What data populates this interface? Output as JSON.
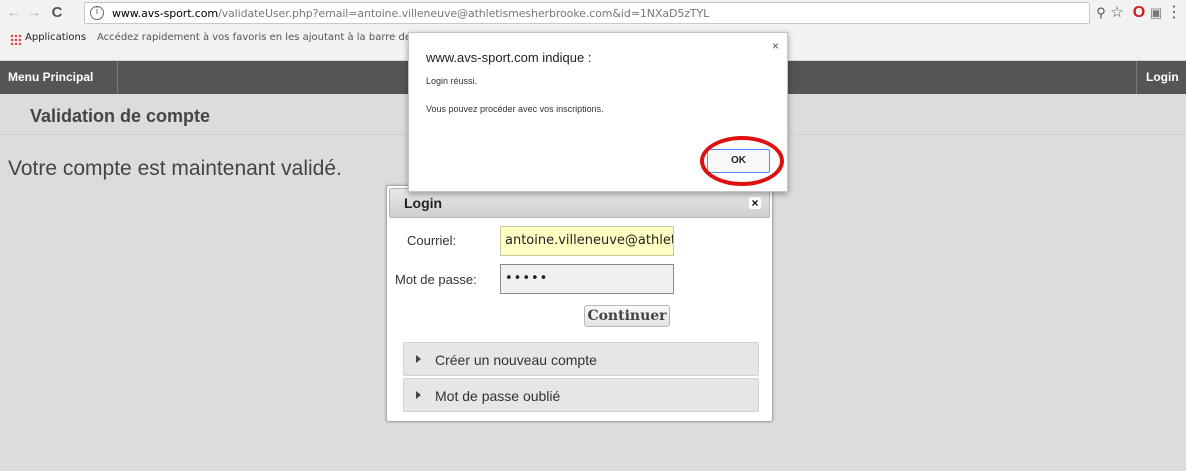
{
  "browser": {
    "url_host": "www.avs-sport.com",
    "url_rest": "/validateUser.php?email=antoine.villeneuve@athletismesherbrooke.com&id=1NXaD5zTYL",
    "apps_label": "Applications",
    "bookmarks_hint": "Accédez rapidement à vos favoris en les ajoutant à la barre de favo",
    "icons": {
      "back": "←",
      "forward": "→",
      "reload": "C",
      "info": "i",
      "key": "⚲",
      "star": "☆",
      "opera": "O",
      "extension": "▣",
      "menu": "⋮"
    }
  },
  "menu": {
    "main_label": "Menu Principal",
    "login_label": "Login"
  },
  "page": {
    "title": "Validation de compte",
    "message": "Votre compte est maintenant validé."
  },
  "login_dialog": {
    "title": "Login",
    "close_glyph": "×",
    "email_label": "Courriel:",
    "email_value": "antoine.villeneuve@athletis",
    "password_label": "Mot de passe:",
    "password_value": "•••••",
    "continue_label": "Continuer",
    "create_account_label": "Créer un nouveau compte",
    "forgot_password_label": "Mot de passe oublié"
  },
  "alert": {
    "title": "www.avs-sport.com indique :",
    "close_glyph": "×",
    "line1": "Login réussi.",
    "line2": "Vous pouvez procéder avec vos inscriptions.",
    "ok_label": "OK"
  },
  "colors": {
    "menu_bar": "#555555",
    "page_bg": "#dcdcdc",
    "email_highlight": "#ffffc4",
    "annotation_ring": "#e01010",
    "opera_red": "#cc1c1c"
  }
}
